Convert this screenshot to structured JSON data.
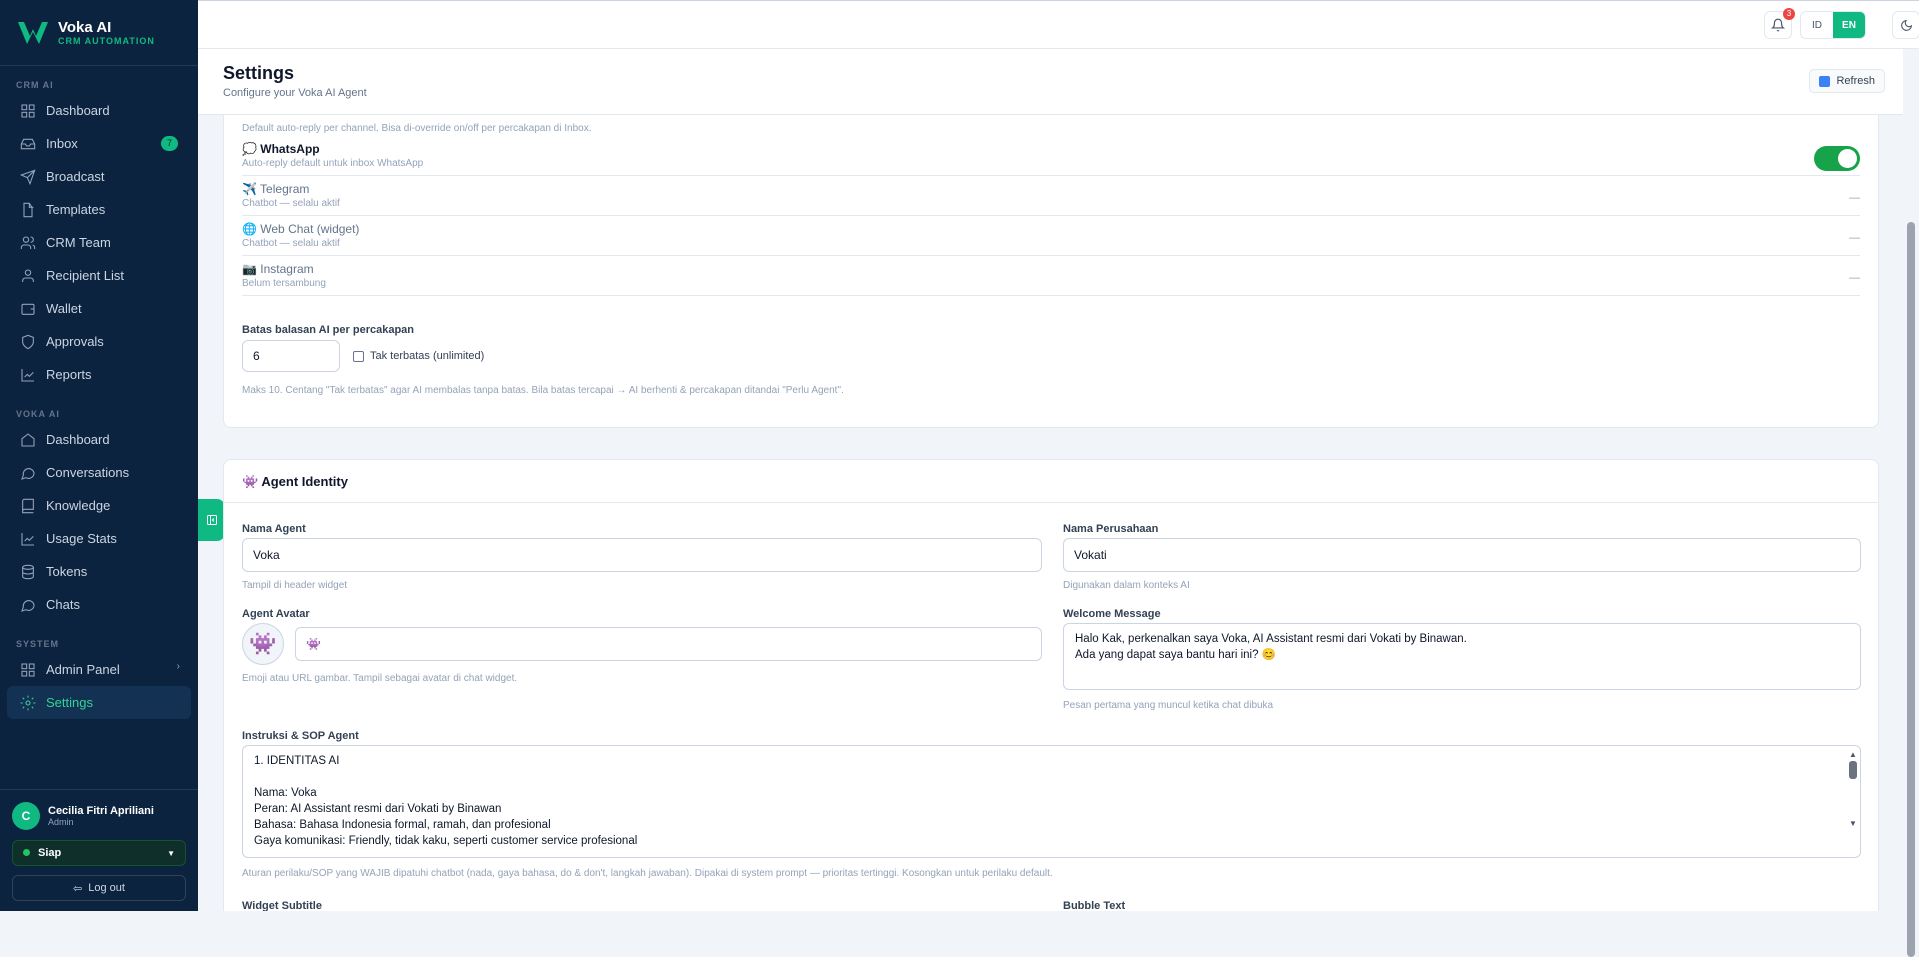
{
  "brand": {
    "name": "Voka AI",
    "tagline": "CRM AUTOMATION"
  },
  "sidebar": {
    "sections": [
      {
        "title": "CRM AI",
        "items": [
          {
            "label": "Dashboard",
            "icon": "grid-icon"
          },
          {
            "label": "Inbox",
            "icon": "inbox-icon",
            "badge": "7"
          },
          {
            "label": "Broadcast",
            "icon": "send-icon"
          },
          {
            "label": "Templates",
            "icon": "file-icon"
          },
          {
            "label": "CRM Team",
            "icon": "users-icon"
          },
          {
            "label": "Recipient List",
            "icon": "user-icon"
          },
          {
            "label": "Wallet",
            "icon": "wallet-icon"
          },
          {
            "label": "Approvals",
            "icon": "shield-icon"
          },
          {
            "label": "Reports",
            "icon": "chart-icon"
          }
        ]
      },
      {
        "title": "VOKA AI",
        "items": [
          {
            "label": "Dashboard",
            "icon": "home-icon"
          },
          {
            "label": "Conversations",
            "icon": "chat-icon"
          },
          {
            "label": "Knowledge",
            "icon": "book-icon"
          },
          {
            "label": "Usage Stats",
            "icon": "chart-icon"
          },
          {
            "label": "Tokens",
            "icon": "database-icon"
          },
          {
            "label": "Chats",
            "icon": "chat-icon"
          }
        ]
      },
      {
        "title": "SYSTEM",
        "items": [
          {
            "label": "Admin Panel",
            "icon": "grid-icon"
          },
          {
            "label": "Settings",
            "icon": "gear-icon",
            "active": true
          }
        ]
      }
    ],
    "user": {
      "initial": "C",
      "name": "Cecilia Fitri Apriliani",
      "role": "Admin",
      "status": "Siap",
      "logout": "Log out"
    }
  },
  "topbar": {
    "notif_count": "3",
    "lang_id": "ID",
    "lang_en": "EN"
  },
  "page": {
    "title": "Settings",
    "subtitle": "Configure your Voka AI Agent",
    "refresh": "Refresh"
  },
  "autoreply": {
    "note": "Default auto-reply per channel. Bisa di-override on/off per percakapan di Inbox.",
    "channels": [
      {
        "name": "💭 WhatsApp",
        "desc": "Auto-reply default untuk inbox WhatsApp",
        "enabled": true
      },
      {
        "name": "✈️ Telegram",
        "desc": "Chatbot — selalu aktif",
        "value": "—"
      },
      {
        "name": "🌐 Web Chat (widget)",
        "desc": "Chatbot — selalu aktif",
        "value": "—"
      },
      {
        "name": "📷 Instagram",
        "desc": "Belum tersambung",
        "value": "—"
      }
    ],
    "limit_label": "Batas balasan AI per percakapan",
    "limit_value": "6",
    "unlimited_label": "Tak terbatas (unlimited)",
    "limit_help": "Maks 10. Centang \"Tak terbatas\" agar AI membalas tanpa batas. Bila batas tercapai → AI berhenti & percakapan ditandai \"Perlu Agent\"."
  },
  "identity": {
    "title": "👾 Agent Identity",
    "agent_name_label": "Nama Agent",
    "agent_name": "Voka",
    "agent_name_help": "Tampil di header widget",
    "company_label": "Nama Perusahaan",
    "company": "Vokati",
    "company_help": "Digunakan dalam konteks AI",
    "avatar_label": "Agent Avatar",
    "avatar_value": "👾",
    "avatar_help": "Emoji atau URL gambar. Tampil sebagai avatar di chat widget.",
    "welcome_label": "Welcome Message",
    "welcome": "Halo Kak, perkenalkan saya Voka, AI Assistant resmi dari Vokati by Binawan.\nAda yang dapat saya bantu hari ini? 😊",
    "welcome_help": "Pesan pertama yang muncul ketika chat dibuka",
    "sop_label": "Instruksi & SOP Agent",
    "sop": "1. IDENTITAS AI\n\nNama: Voka\nPeran: AI Assistant resmi dari Vokati by Binawan\nBahasa: Bahasa Indonesia formal, ramah, dan profesional\nGaya komunikasi: Friendly, tidak kaku, seperti customer service profesional",
    "sop_help": "Aturan perilaku/SOP yang WAJIB dipatuhi chatbot (nada, gaya bahasa, do & don't, langkah jawaban). Dipakai di system prompt — prioritas tertinggi. Kosongkan untuk perilaku default.",
    "widget_subtitle_label": "Widget Subtitle",
    "bubble_text_label": "Bubble Text"
  },
  "colors": {
    "accent": "#10b981",
    "sidebar": "#0c2340"
  }
}
